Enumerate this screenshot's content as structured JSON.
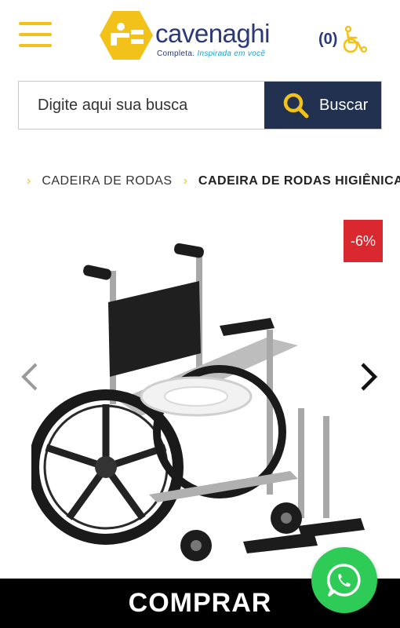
{
  "header": {
    "brand": "cavenaghi",
    "tagline_part1": "Completa.",
    "tagline_part2": "Inspirada em você",
    "cart_count": "(0)"
  },
  "search": {
    "placeholder": "Digite aqui sua busca",
    "button_label": "Buscar"
  },
  "breadcrumb": {
    "items": [
      "CADEIRA DE RODAS",
      "CADEIRA DE RODAS HIGIÊNICA E B"
    ]
  },
  "product": {
    "discount_badge": "-6%"
  },
  "footer": {
    "buy_label": "COMPRAR"
  },
  "colors": {
    "accent_yellow": "#f2c21b",
    "brand_blue": "#2a3a78",
    "search_button": "#22314f",
    "discount_red": "#d9282f",
    "whatsapp_green": "#2ecc57"
  },
  "icons": [
    "menu-icon",
    "logo-icon",
    "wheelchair-cart-icon",
    "search-icon",
    "chevron-left-icon",
    "chevron-right-icon",
    "whatsapp-icon"
  ]
}
